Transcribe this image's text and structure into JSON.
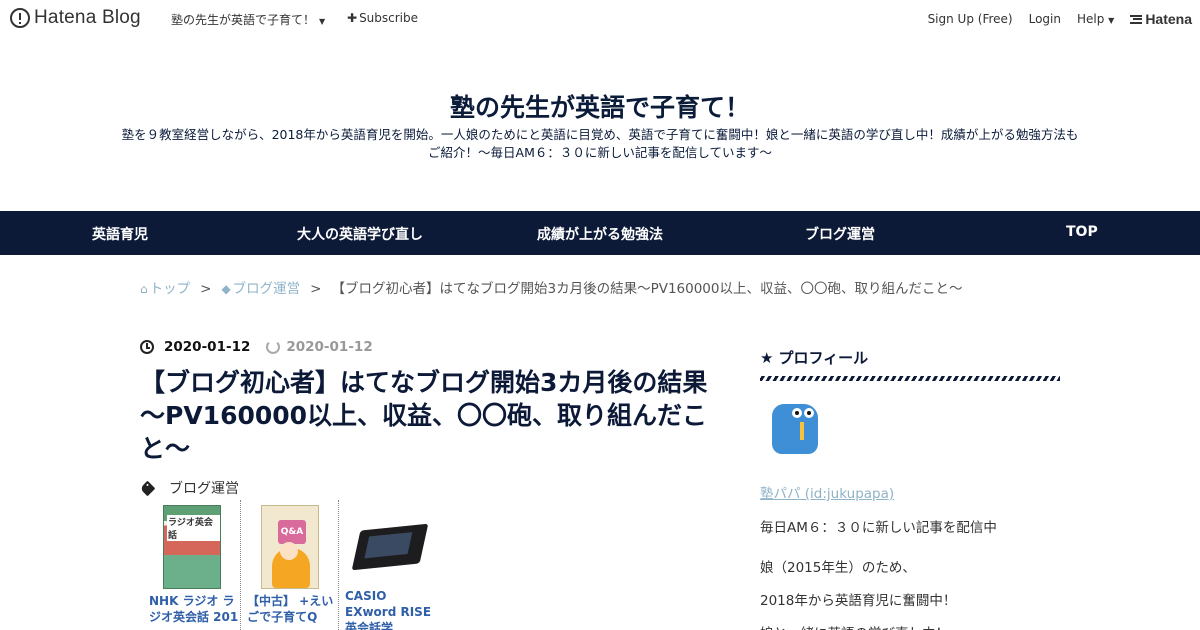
{
  "topbar": {
    "brand": "Hatena Blog",
    "blog_name": "塾の先生が英語で子育て！",
    "subscribe": "Subscribe",
    "signup": "Sign Up (Free)",
    "login": "Login",
    "help": "Help",
    "hatena": "Hatena"
  },
  "header": {
    "title": "塾の先生が英語で子育て！",
    "description_line1": "塾を９教室経営しながら、2018年から英語育児を開始。一人娘のためにと英語に目覚め、英語で子育てに奮闘中！娘と一緒に英語の学び直し中！成績が上がる勉強方法も",
    "description_line2": "ご紹介！～毎日AM６：３０に新しい記事を配信しています～"
  },
  "nav": {
    "items": [
      "英語育児",
      "大人の英語学び直し",
      "成績が上がる勉強法",
      "ブログ運営",
      "TOP"
    ]
  },
  "breadcrumb": {
    "home": "トップ",
    "category": "ブログ運営",
    "sep": ">",
    "current": "【ブログ初心者】はてなブログ開始3カ月後の結果～PV160000以上、収益、〇〇砲、取り組んだこと～"
  },
  "article": {
    "date_published": "2020-01-12",
    "date_updated": "2020-01-12",
    "title": "【ブログ初心者】はてなブログ開始3カ月後の結果～PV160000以上、収益、〇〇砲、取り組んだこと～",
    "category": "ブログ運営",
    "products": [
      {
        "title": "NHK ラジオ ラジオ英会話 201",
        "cover_text": "ラジオ英会話"
      },
      {
        "title": "【中古】 +えいごで子育てQ",
        "cover_text": "Q&A"
      },
      {
        "title": "CASIO EXword RISE 英会話学"
      }
    ]
  },
  "sidebar": {
    "heading": "プロフィール",
    "user": "塾パパ (id:jukupapa)",
    "line1": "毎日AM６：３０に新しい記事を配信中",
    "line2": "娘（2015年生）のため、",
    "line3": "2018年から英語育児に奮闘中！",
    "line4": "娘と一緒に英語の学び直し中！"
  }
}
